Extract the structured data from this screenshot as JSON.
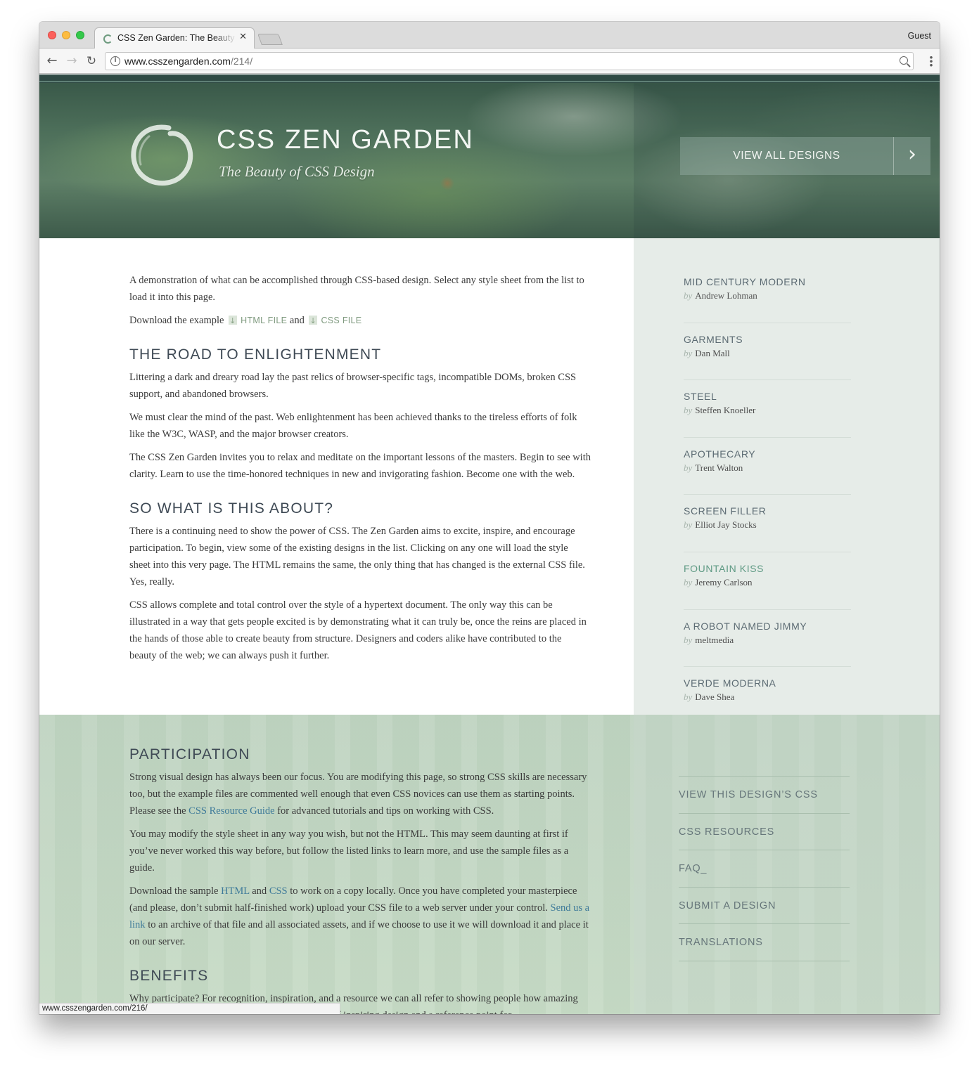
{
  "browser": {
    "tab_title": "CSS Zen Garden: The Beauty of CSS Design",
    "tab_close": "✕",
    "profile": "Guest",
    "url_host": "www.csszengarden.com",
    "url_path": "/214/",
    "status_url": "www.csszengarden.com/216/"
  },
  "header": {
    "title": "CSS ZEN GARDEN",
    "tagline": "The Beauty of CSS Design",
    "view_all_label": "VIEW ALL DESIGNS",
    "view_all_arrow": "›"
  },
  "intro": {
    "summary": "A demonstration of what can be accomplished through CSS-based design. Select any style sheet from the list to load it into this page.",
    "download_prefix": "Download the example",
    "html_file": "HTML FILE",
    "and": "and",
    "css_file": "CSS FILE"
  },
  "sections": {
    "road": {
      "heading": "THE ROAD TO ENLIGHTENMENT",
      "p1": "Littering a dark and dreary road lay the past relics of browser-specific tags, incompatible DOMs, broken CSS support, and abandoned browsers.",
      "p2": "We must clear the mind of the past. Web enlightenment has been achieved thanks to the tireless efforts of folk like the W3C, WASP, and the major browser creators.",
      "p3": "The CSS Zen Garden invites you to relax and meditate on the important lessons of the masters. Begin to see with clarity. Learn to use the time-honored techniques in new and invigorating fashion. Become one with the web."
    },
    "about": {
      "heading": "SO WHAT IS THIS ABOUT?",
      "p1": "There is a continuing need to show the power of CSS. The Zen Garden aims to excite, inspire, and encourage participation. To begin, view some of the existing designs in the list. Clicking on any one will load the style sheet into this very page. The HTML remains the same, the only thing that has changed is the external CSS file. Yes, really.",
      "p2": "CSS allows complete and total control over the style of a hypertext document. The only way this can be illustrated in a way that gets people excited is by demonstrating what it can truly be, once the reins are placed in the hands of those able to create beauty from structure. Designers and coders alike have contributed to the beauty of the web; we can always push it further."
    },
    "participation": {
      "heading": "PARTICIPATION",
      "p1_a": "Strong visual design has always been our focus. You are modifying this page, so strong CSS skills are necessary too, but the example files are commented well enough that even CSS novices can use them as starting points. Please see the ",
      "p1_link": "CSS Resource Guide",
      "p1_b": " for advanced tutorials and tips on working with CSS.",
      "p2": "You may modify the style sheet in any way you wish, but not the HTML. This may seem daunting at first if you’ve never worked this way before, but follow the listed links to learn more, and use the sample files as a guide.",
      "p3_a": "Download the sample ",
      "p3_html": "HTML",
      "p3_and": " and ",
      "p3_css": "CSS",
      "p3_b": " to work on a copy locally. Once you have completed your masterpiece (and please, don’t submit half-finished work) upload your CSS file to a web server under your control. ",
      "p3_link": "Send us a link",
      "p3_c": " to an archive of that file and all associated assets, and if we choose to use it we will download it and place it on our server."
    },
    "benefits": {
      "heading": "BENEFITS",
      "p1": "Why participate? For recognition, inspiration, and a resource we can all refer to showing people how amazing CSS really can be. This site serves as a showcase of inspiring design and a reference point for"
    }
  },
  "design_list": {
    "by": "by",
    "items": [
      {
        "name": "MID CENTURY MODERN",
        "author": "Andrew Lohman"
      },
      {
        "name": "GARMENTS",
        "author": "Dan Mall"
      },
      {
        "name": "STEEL",
        "author": "Steffen Knoeller"
      },
      {
        "name": "APOTHECARY",
        "author": "Trent Walton"
      },
      {
        "name": "SCREEN FILLER",
        "author": "Elliot Jay Stocks"
      },
      {
        "name": "FOUNTAIN KISS",
        "author": "Jeremy Carlson"
      },
      {
        "name": "A ROBOT NAMED JIMMY",
        "author": "meltmedia"
      },
      {
        "name": "VERDE MODERNA",
        "author": "Dave Shea"
      }
    ]
  },
  "resources": {
    "items": [
      "VIEW THIS DESIGN’S CSS",
      "CSS RESOURCES",
      "FAQ_",
      "SUBMIT A DESIGN",
      "TRANSLATIONS"
    ]
  },
  "icons": {
    "back": "←",
    "forward": "→",
    "reload": "↻",
    "info": "i"
  }
}
